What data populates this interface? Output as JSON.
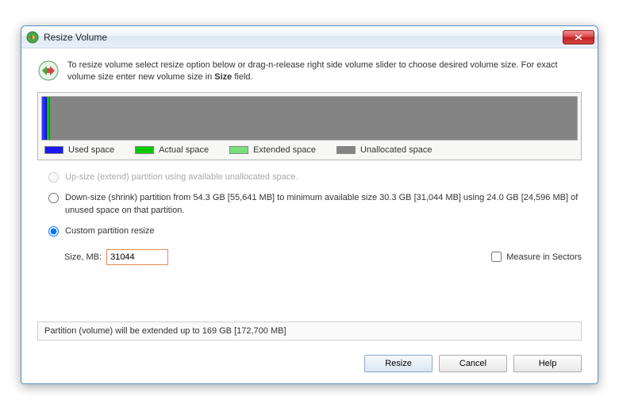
{
  "window": {
    "title": "Resize Volume"
  },
  "intro": {
    "line1": "To resize volume select resize option below or drag-n-release right side volume slider to choose desired volume size. For exact volume size enter new volume size in ",
    "bold": "Size",
    "line2": " field."
  },
  "legend": {
    "used": "Used space",
    "actual": "Actual space",
    "extended": "Extended space",
    "unallocated": "Unallocated space",
    "colors": {
      "used": "#1a1af0",
      "actual": "#00c800",
      "extended": "#79e079",
      "unallocated": "#848484"
    }
  },
  "options": {
    "upsize": "Up-size (extend) partition using available unallocated space.",
    "downsize": "Down-size (shrink) partition from 54.3 GB [55,641 MB] to minimum available size 30.3 GB [31,044 MB] using 24.0 GB [24,596 MB] of unused space on that partition.",
    "custom": "Custom partition resize"
  },
  "size": {
    "label": "Size, MB:",
    "value": "31044",
    "measure_label": "Measure in Sectors"
  },
  "status": "Partition (volume) will be extended up to 169 GB [172,700 MB]",
  "buttons": {
    "resize": "Resize",
    "cancel": "Cancel",
    "help": "Help"
  }
}
